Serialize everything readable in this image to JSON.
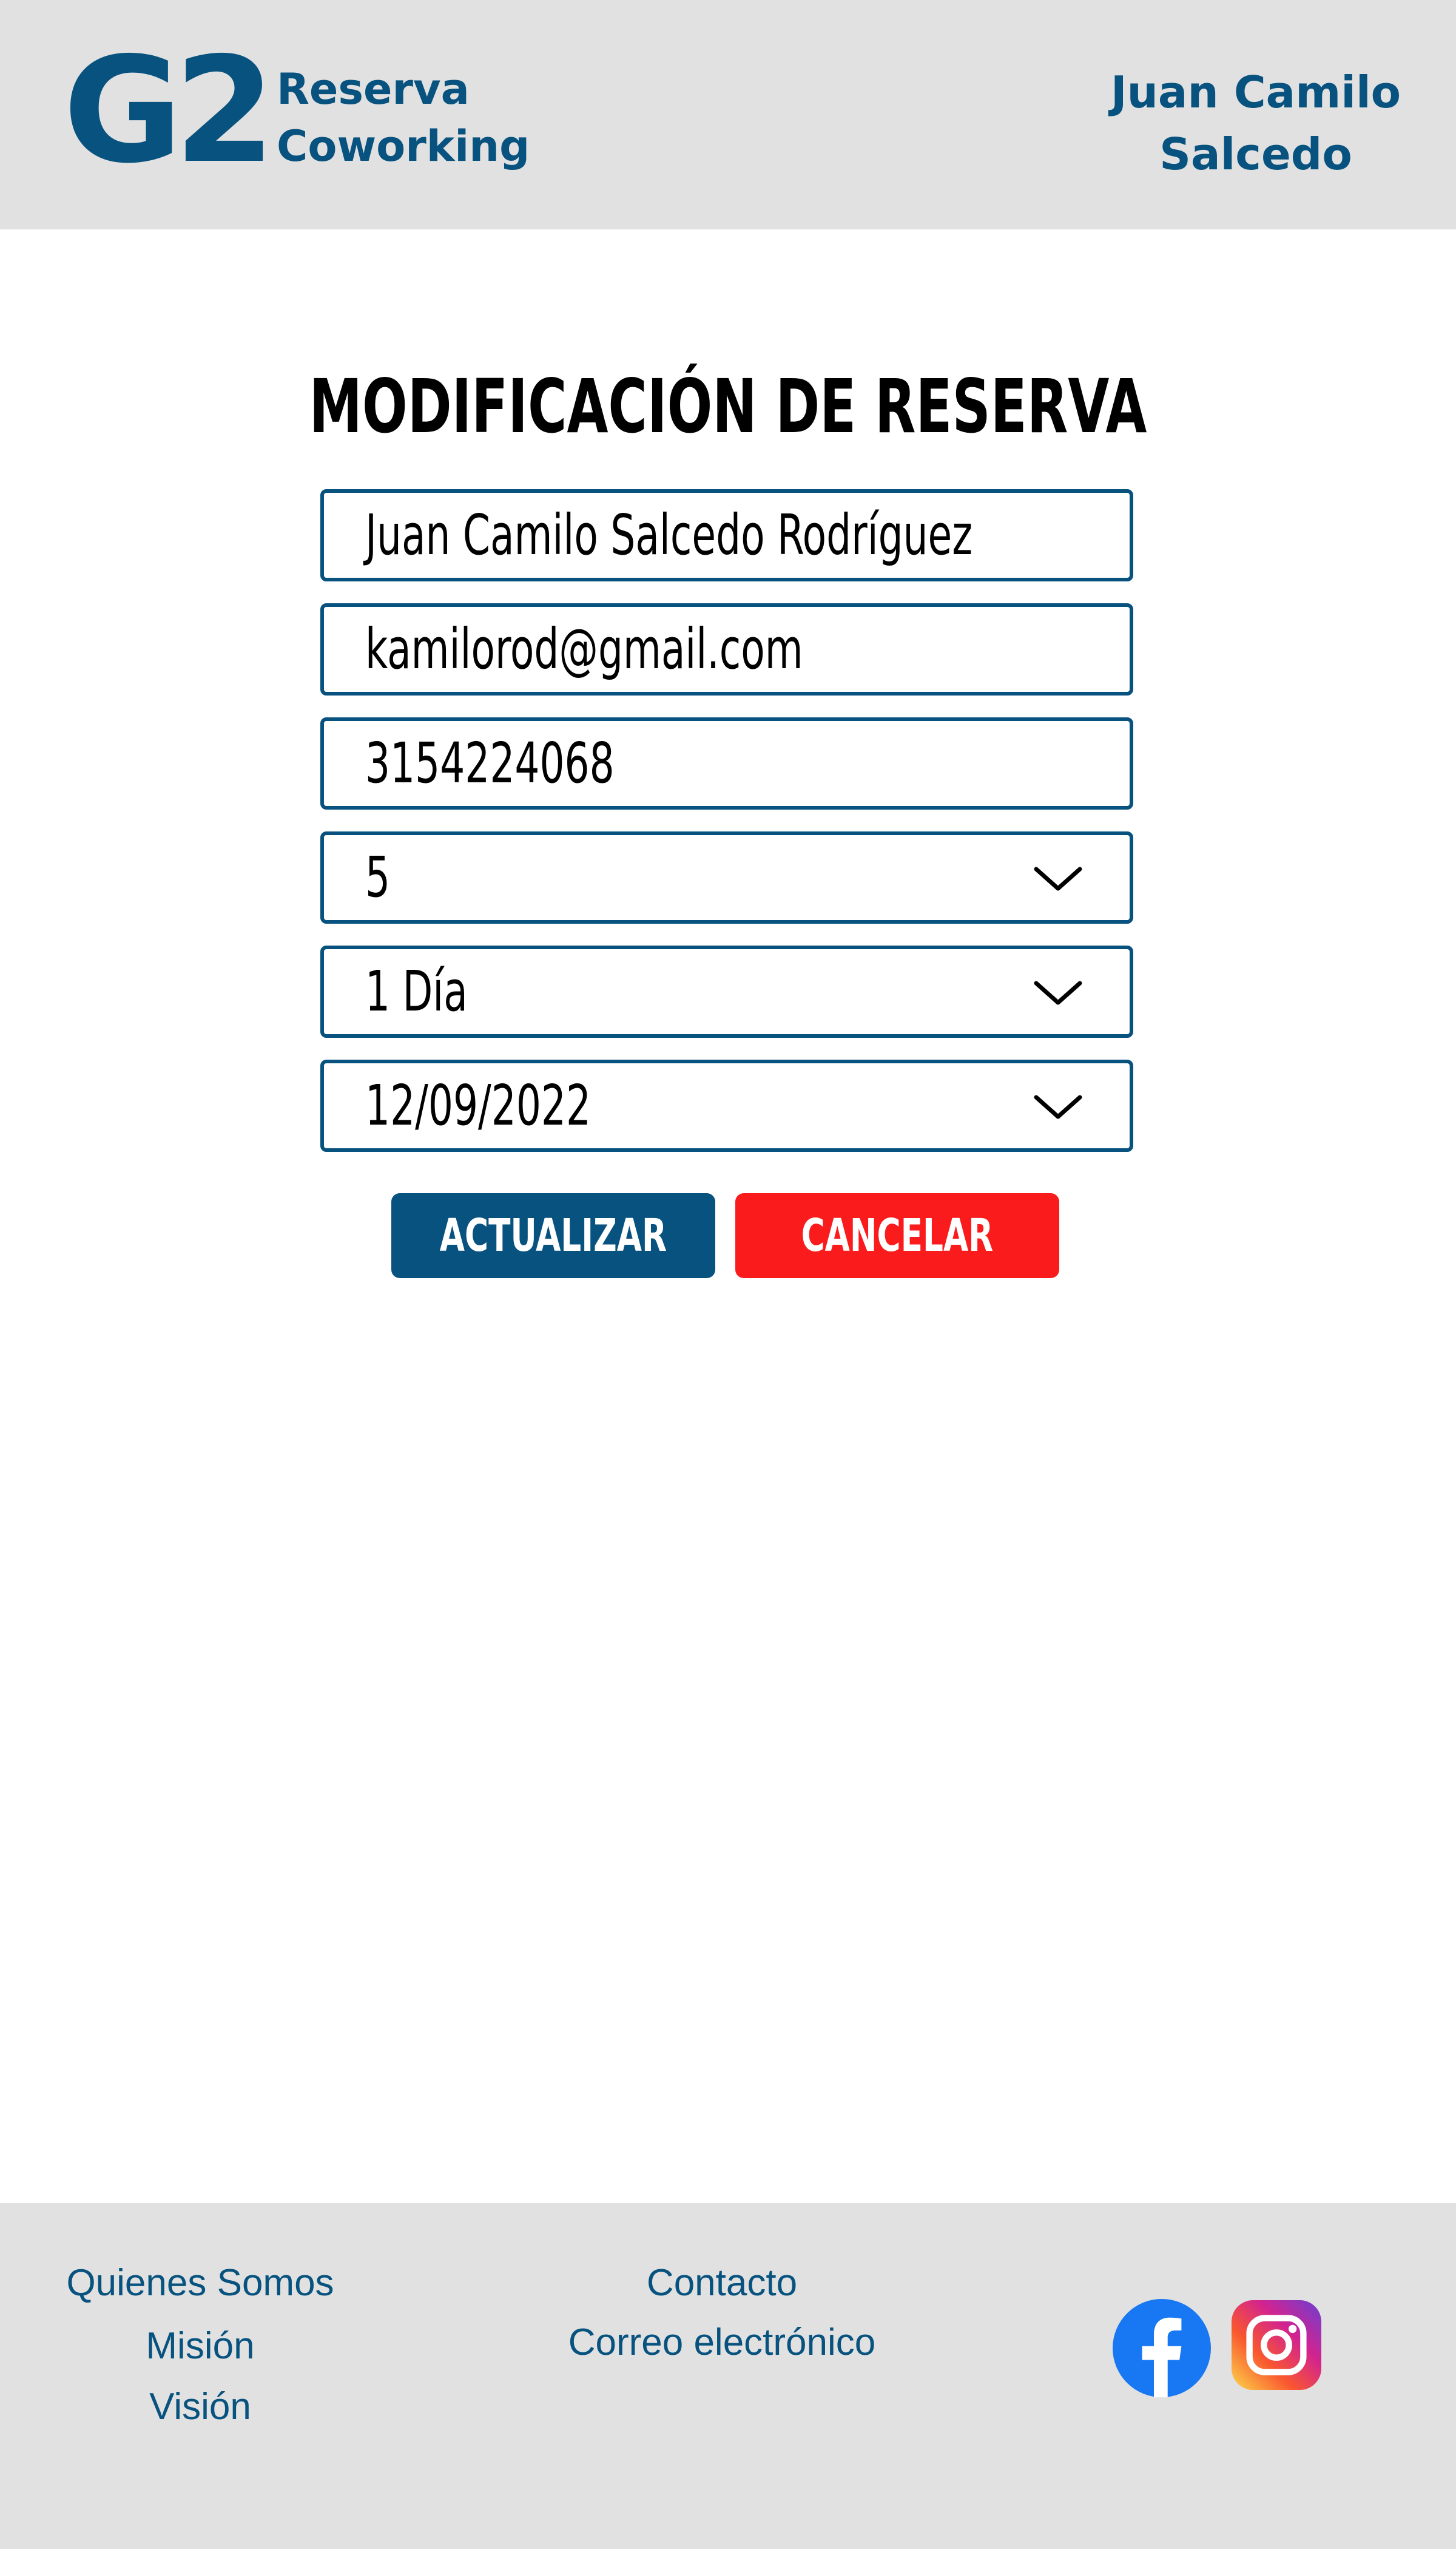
{
  "header": {
    "logo_mark": "G2",
    "logo_line1": "Reserva",
    "logo_line2": "Coworking",
    "user_line1": "Juan Camilo",
    "user_line2": "Salcedo"
  },
  "main": {
    "title": "MODIFICACIÓN DE RESERVA",
    "fields": {
      "name": "Juan Camilo Salcedo Rodríguez",
      "email": "kamilorod@gmail.com",
      "phone": "3154224068",
      "people": "5",
      "duration": "1 Día",
      "date": "12/09/2022"
    },
    "update_label": "ACTUALIZAR",
    "cancel_label": "CANCELAR"
  },
  "footer": {
    "links_left": [
      "Quienes Somos",
      "Misión",
      "Visión"
    ],
    "links_center": [
      "Contacto",
      "Correo electrónico"
    ],
    "social_icons": [
      "facebook-icon",
      "instagram-icon"
    ]
  },
  "colors": {
    "brand_blue": "#07527e",
    "cancel_red": "#fa1c1c",
    "header_bg": "#e1e1e1"
  }
}
